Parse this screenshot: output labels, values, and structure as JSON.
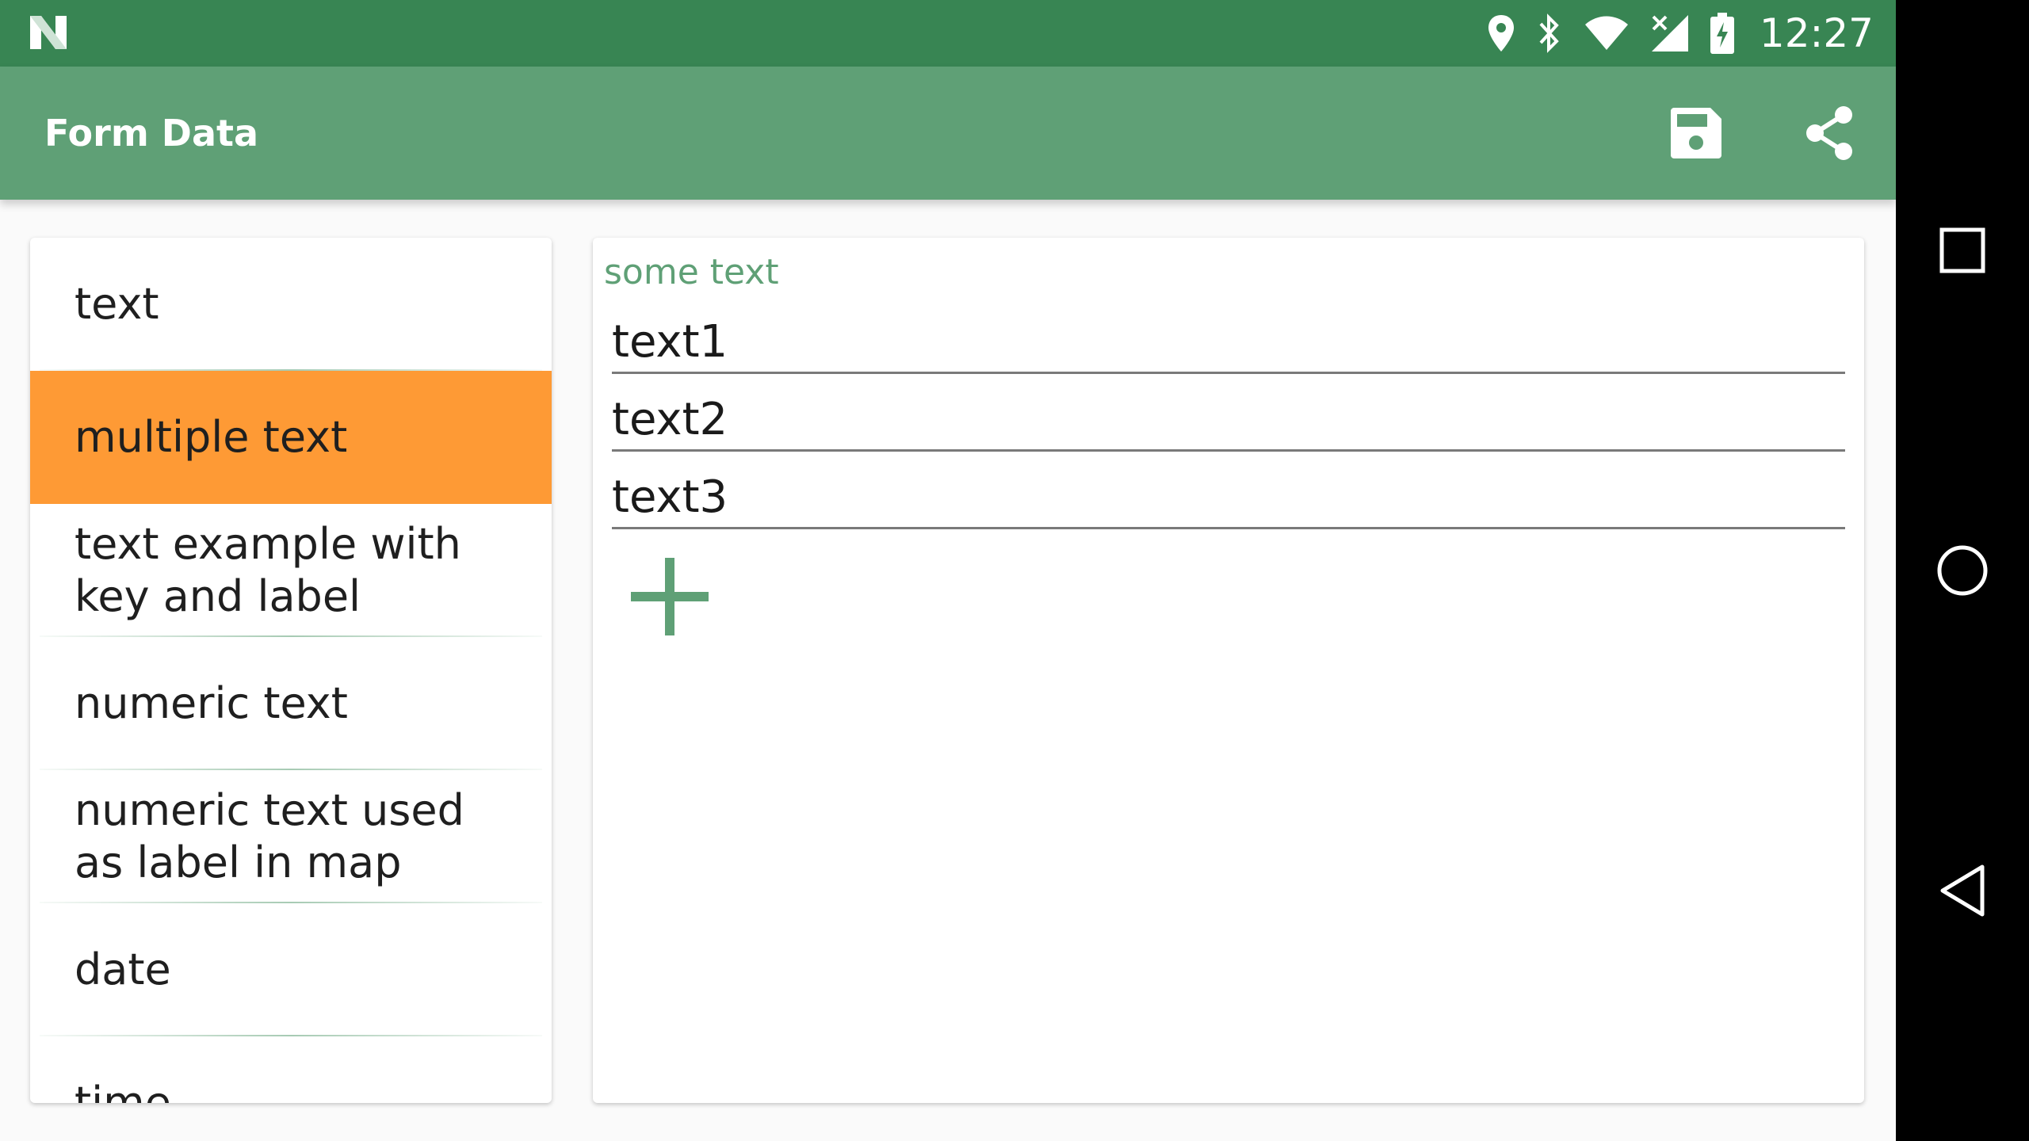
{
  "status_bar": {
    "time": "12:27",
    "icons": [
      "n-notification-icon",
      "location-icon",
      "bluetooth-icon",
      "wifi-icon",
      "signal-icon",
      "battery-charging-icon"
    ]
  },
  "toolbar": {
    "title": "Form Data",
    "actions": [
      "save-icon",
      "share-icon"
    ]
  },
  "sidebar": {
    "items": [
      {
        "label": "text"
      },
      {
        "label": "multiple text",
        "selected": true
      },
      {
        "label": "text example with key and label"
      },
      {
        "label": "numeric text"
      },
      {
        "label": "numeric text used as label in map"
      },
      {
        "label": "date"
      },
      {
        "label": "time"
      }
    ]
  },
  "detail": {
    "field_label": "some text",
    "entries": [
      {
        "value": "text1"
      },
      {
        "value": "text2"
      },
      {
        "value": "text3"
      }
    ],
    "add_icon": "plus-icon"
  },
  "nav_bar": {
    "buttons": [
      "recents-icon",
      "home-icon",
      "back-icon"
    ]
  },
  "colors": {
    "status_bar": "#388553",
    "toolbar": "#5fa076",
    "accent": "#5fa076",
    "selected_item": "#fe9a35"
  }
}
